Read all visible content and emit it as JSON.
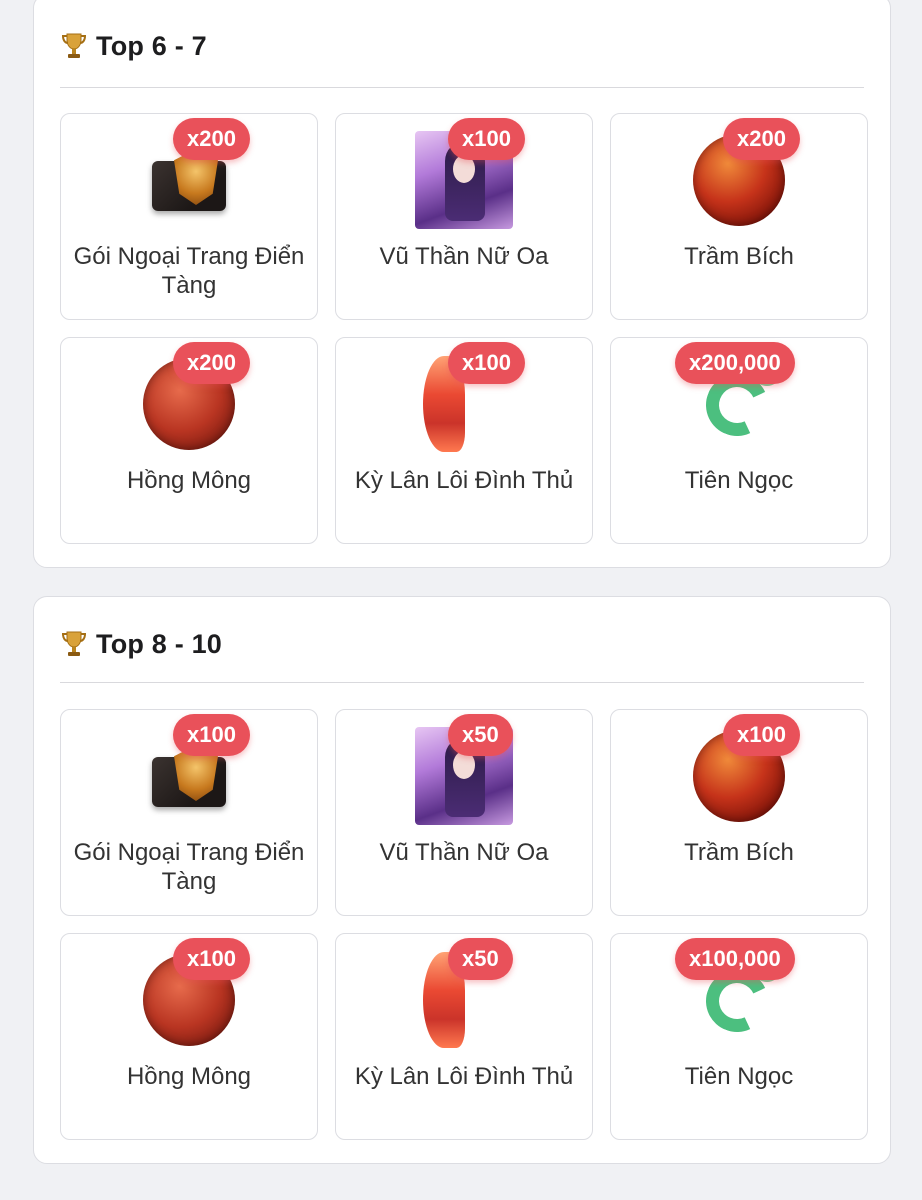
{
  "sections": [
    {
      "title": "Top 6 - 7",
      "items": [
        {
          "name": "Gói Ngoại Trang Điển Tàng",
          "qty": "x200",
          "icon": "chest-mask-icon"
        },
        {
          "name": "Vũ Thần Nữ Oa",
          "qty": "x100",
          "icon": "nu-oa-portrait-icon"
        },
        {
          "name": "Trầm Bích",
          "qty": "x200",
          "icon": "red-orb-icon"
        },
        {
          "name": "Hồng Mông",
          "qty": "x200",
          "icon": "red-warrior-orb-icon"
        },
        {
          "name": "Kỳ Lân Lôi Đình Thủ",
          "qty": "x100",
          "icon": "fire-claw-icon"
        },
        {
          "name": "Tiên Ngọc",
          "qty": "x200,000",
          "icon": "jade-dragon-icon"
        }
      ]
    },
    {
      "title": "Top 8 - 10",
      "items": [
        {
          "name": "Gói Ngoại Trang Điển Tàng",
          "qty": "x100",
          "icon": "chest-mask-icon"
        },
        {
          "name": "Vũ Thần Nữ Oa",
          "qty": "x50",
          "icon": "nu-oa-portrait-icon"
        },
        {
          "name": "Trầm Bích",
          "qty": "x100",
          "icon": "red-orb-icon"
        },
        {
          "name": "Hồng Mông",
          "qty": "x100",
          "icon": "red-warrior-orb-icon"
        },
        {
          "name": "Kỳ Lân Lôi Đình Thủ",
          "qty": "x50",
          "icon": "fire-claw-icon"
        },
        {
          "name": "Tiên Ngọc",
          "qty": "x100,000",
          "icon": "jade-dragon-icon"
        }
      ]
    }
  ],
  "colors": {
    "badge": "#e9515a",
    "trophy": "#d9a23a",
    "card_border": "#dcdde2"
  }
}
